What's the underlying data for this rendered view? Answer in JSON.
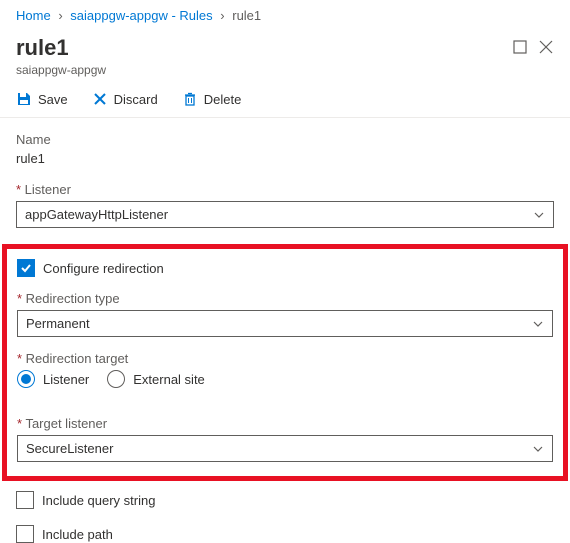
{
  "breadcrumb": {
    "home": "Home",
    "parent": "saiappgw-appgw - Rules",
    "current": "rule1"
  },
  "header": {
    "title": "rule1",
    "subtitle": "saiappgw-appgw"
  },
  "toolbar": {
    "save": "Save",
    "discard": "Discard",
    "delete": "Delete"
  },
  "form": {
    "name_label": "Name",
    "name_value": "rule1",
    "listener_label": "Listener",
    "listener_value": "appGatewayHttpListener",
    "configure_redirection": "Configure redirection",
    "redirection_type_label": "Redirection type",
    "redirection_type_value": "Permanent",
    "redirection_target_label": "Redirection target",
    "target_listener_option": "Listener",
    "target_external_option": "External site",
    "target_listener_label": "Target listener",
    "target_listener_value": "SecureListener",
    "include_query": "Include query string",
    "include_path": "Include path"
  }
}
